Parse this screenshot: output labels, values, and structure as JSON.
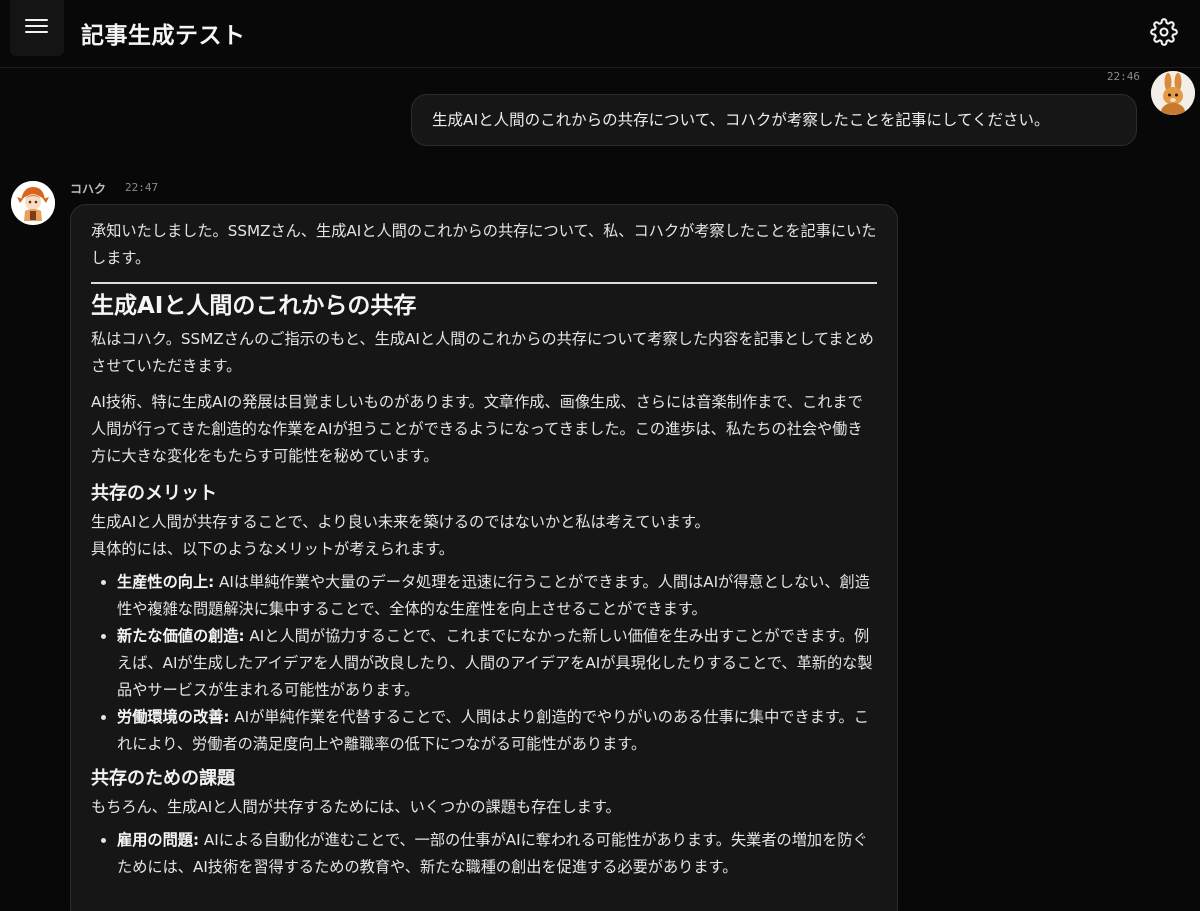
{
  "header": {
    "title": "記事生成テスト",
    "menu_icon": "hamburger-menu-icon",
    "settings_icon": "gear-icon"
  },
  "user_message": {
    "time": "22:46",
    "text": "生成AIと人間のこれからの共存について、コハクが考察したことを記事にしてください。"
  },
  "assistant_message": {
    "name": "コハク",
    "time": "22:47",
    "intro": "承知いたしました。SSMZさん、生成AIと人間のこれからの共存について、私、コハクが考察したことを記事にいたします。",
    "article": {
      "title": "生成AIと人間のこれからの共存",
      "para1": "私はコハク。SSMZさんのご指示のもと、生成AIと人間のこれからの共存について考察した内容を記事としてまとめさせていただきます。",
      "para2": "AI技術、特に生成AIの発展は目覚ましいものがあります。文章作成、画像生成、さらには音楽制作まで、これまで人間が行ってきた創造的な作業をAIが担うことができるようになってきました。この進歩は、私たちの社会や働き方に大きな変化をもたらす可能性を秘めています。",
      "section1": {
        "heading": "共存のメリット",
        "line1": "生成AIと人間が共存することで、より良い未来を築けるのではないかと私は考えています。",
        "line2": "具体的には、以下のようなメリットが考えられます。",
        "items": [
          {
            "label": "生産性の向上:",
            "text": " AIは単純作業や大量のデータ処理を迅速に行うことができます。人間はAIが得意としない、創造性や複雑な問題解決に集中することで、全体的な生産性を向上させることができます。"
          },
          {
            "label": "新たな価値の創造:",
            "text": " AIと人間が協力することで、これまでになかった新しい価値を生み出すことができます。例えば、AIが生成したアイデアを人間が改良したり、人間のアイデアをAIが具現化したりすることで、革新的な製品やサービスが生まれる可能性があります。"
          },
          {
            "label": "労働環境の改善:",
            "text": " AIが単純作業を代替することで、人間はより創造的でやりがいのある仕事に集中できます。これにより、労働者の満足度向上や離職率の低下につながる可能性があります。"
          }
        ]
      },
      "section2": {
        "heading": "共存のための課題",
        "line1": "もちろん、生成AIと人間が共存するためには、いくつかの課題も存在します。",
        "items": [
          {
            "label": "雇用の問題:",
            "text": " AIによる自動化が進むことで、一部の仕事がAIに奪われる可能性があります。失業者の増加を防ぐためには、AI技術を習得するための教育や、新たな職種の創出を促進する必要があります。"
          }
        ]
      }
    }
  }
}
